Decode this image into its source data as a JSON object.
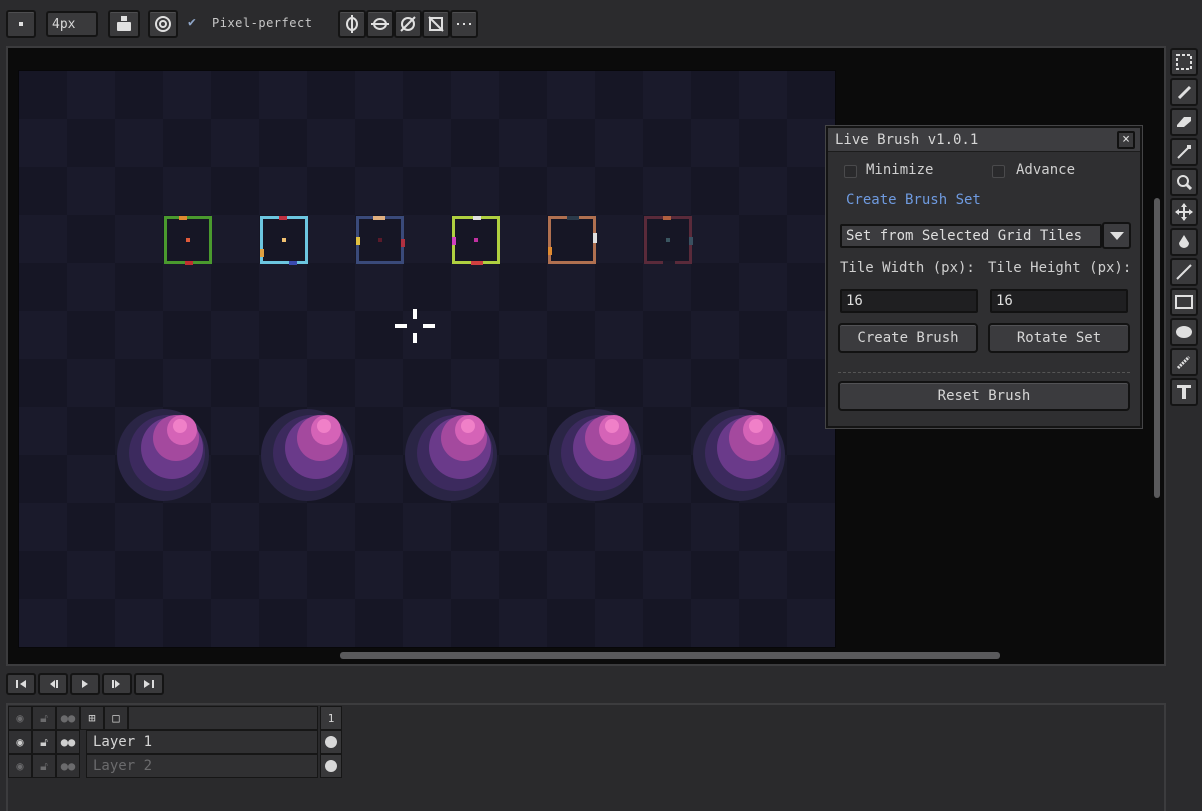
{
  "toolbar": {
    "brush_size": "4px",
    "pixel_perfect_label": "Pixel-perfect",
    "pixel_perfect_checked": true,
    "icons": [
      "brush-preview-icon",
      "ink-icon",
      "pressure-icon",
      "symmetry-vertical-icon",
      "symmetry-horizontal-icon",
      "symmetry-diagonal-icon",
      "symmetry-off-icon",
      "more-options-icon"
    ]
  },
  "canvas": {
    "tile_colors": [
      "#4a9a2e",
      "#6cc6e0",
      "#3a4a7a",
      "#b0d040",
      "#b07050",
      "#5a2a3a"
    ],
    "orb_colors": [
      "#2a2545",
      "#3c2a5e",
      "#6a3a8a",
      "#a4499e",
      "#d563b7",
      "#f080c8"
    ]
  },
  "tools": [
    "marquee-select-icon",
    "pencil-icon",
    "eraser-icon",
    "eyedropper-icon",
    "zoom-icon",
    "move-icon",
    "paint-bucket-icon",
    "line-icon",
    "rectangle-icon",
    "ellipse-icon",
    "spray-icon",
    "text-icon"
  ],
  "live_brush": {
    "title": "Live Brush v1.0.1",
    "close": "×",
    "minimize_label": "Minimize",
    "advance_label": "Advance",
    "section_link": "Create Brush Set",
    "source_select": "Set from Selected Grid Tiles",
    "tile_width_label": "Tile Width (px):",
    "tile_height_label": "Tile Height (px):",
    "tile_width": "16",
    "tile_height": "16",
    "create_brush": "Create Brush",
    "rotate_set": "Rotate Set",
    "reset_brush": "Reset Brush"
  },
  "timeline": {
    "controls": [
      "first-frame-icon",
      "prev-frame-icon",
      "play-icon",
      "next-frame-icon",
      "last-frame-icon"
    ],
    "frame_header": "1",
    "layers": [
      {
        "name": "Layer 1",
        "visible": true
      },
      {
        "name": "Layer 2",
        "visible": false
      }
    ]
  }
}
